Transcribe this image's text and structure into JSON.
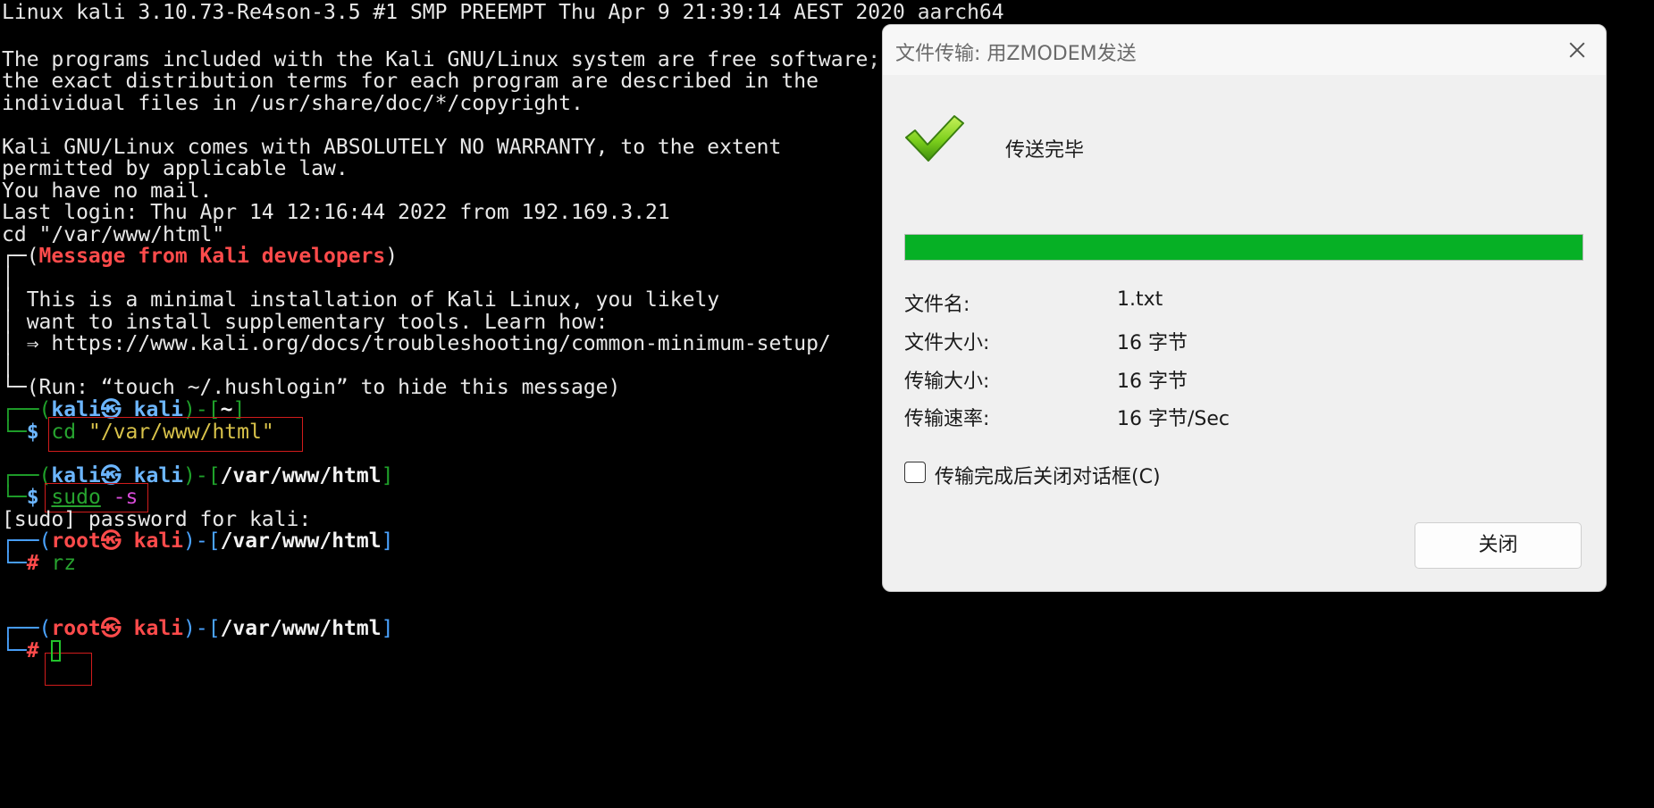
{
  "terminal": {
    "line1": "Linux kali 3.10.73-Re4son-3.5 #1 SMP PREEMPT Thu Apr 9 21:39:14 AEST 2020 aarch64",
    "line3": "The programs included with the Kali GNU/Linux system are free software;",
    "line4": "the exact distribution terms for each program are described in the",
    "line5": "individual files in /usr/share/doc/*/copyright.",
    "line7": "Kali GNU/Linux comes with ABSOLUTELY NO WARRANTY, to the extent",
    "line8": "permitted by applicable law.",
    "line9": "You have no mail.",
    "line10": "Last login: Thu Apr 14 12:16:44 2022 from 192.169.3.21",
    "line11": "cd \"/var/www/html\"",
    "msg_prefix": "┌─(",
    "msg_title": "Message from Kali developers",
    "msg_suffix": ")",
    "bar": "│",
    "msg_line1": "│ This is a minimal installation of Kali Linux, you likely",
    "msg_line2": "│ want to install supplementary tools. Learn how:",
    "msg_line3": "│ ⇒ https://www.kali.org/docs/troubleshooting/common-minimum-setup/",
    "msg_run": "└─(Run: “touch ~/.hushlogin” to hide this message)",
    "prompt1": {
      "user": "kali",
      "at": "㉿",
      "host": "kali",
      "path": "~",
      "symbol": "$",
      "cmd": "cd",
      "arg": "\"/var/www/html\""
    },
    "prompt2": {
      "user": "kali",
      "at": "㉿",
      "host": "kali",
      "path": "/var/www/html",
      "symbol": "$",
      "cmd": "sudo",
      "arg": "-s"
    },
    "sudo_prompt": "[sudo] password for kali:",
    "prompt3": {
      "user": "root",
      "at": "㉿",
      "host": "kali",
      "path": "/var/www/html",
      "symbol": "#",
      "cmd": "rz"
    },
    "prompt4": {
      "user": "root",
      "at": "㉿",
      "host": "kali",
      "path": "/var/www/html",
      "symbol": "#"
    }
  },
  "dialog": {
    "title": "文件传输: 用ZMODEM发送",
    "status": "传送完毕",
    "progress_fraction": 1.0,
    "progress_color": "#06b025",
    "rows": [
      {
        "label": "文件名:",
        "value": "1.txt"
      },
      {
        "label": "文件大小:",
        "value": "16 字节"
      },
      {
        "label": "传输大小:",
        "value": "16 字节"
      },
      {
        "label": "传输速率:",
        "value": "16 字节/Sec"
      }
    ],
    "checkbox_label": "传输完成后关闭对话框(C)",
    "checkbox_checked": false,
    "close_button": "关闭",
    "icons": {
      "close": "close-icon",
      "status": "checkmark-icon"
    }
  }
}
